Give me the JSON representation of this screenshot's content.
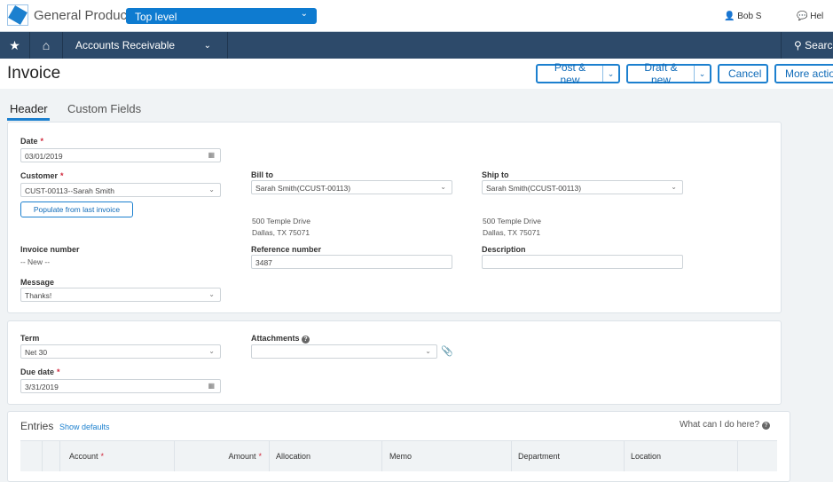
{
  "topbar": {
    "product": "General Product",
    "entity": "Top level",
    "user": "Bob S",
    "help": "Hel"
  },
  "nav": {
    "module": "Accounts Receivable",
    "search": "Search"
  },
  "page": {
    "title": "Invoice"
  },
  "actions": {
    "post_new": "Post & new",
    "draft_new": "Draft & new",
    "cancel": "Cancel",
    "more": "More action"
  },
  "tabs": [
    "Header",
    "Custom Fields"
  ],
  "header": {
    "date_label": "Date",
    "date_value": "03/01/2019",
    "customer_label": "Customer",
    "customer_value": "CUST-00113--Sarah Smith",
    "populate_button": "Populate from last invoice",
    "bill_to_label": "Bill to",
    "bill_to_value": "Sarah Smith(CCUST-00113)",
    "bill_addr1": "500 Temple Drive",
    "bill_addr2": "Dallas, TX 75071",
    "ship_to_label": "Ship to",
    "ship_to_value": "Sarah Smith(CCUST-00113)",
    "ship_addr1": "500 Temple Drive",
    "ship_addr2": "Dallas, TX 75071",
    "invoice_number_label": "Invoice number",
    "invoice_number_value": "-- New --",
    "reference_label": "Reference number",
    "reference_value": "3487",
    "description_label": "Description",
    "description_value": "",
    "message_label": "Message",
    "message_value": "Thanks!"
  },
  "terms": {
    "term_label": "Term",
    "term_value": "Net 30",
    "attachments_label": "Attachments",
    "attachments_value": "",
    "due_label": "Due date",
    "due_value": "3/31/2019"
  },
  "entries": {
    "title": "Entries",
    "show_defaults": "Show defaults",
    "help": "What can I do here?",
    "columns": [
      "Account",
      "Amount",
      "Allocation",
      "Memo",
      "Department",
      "Location"
    ]
  },
  "required_mark": "*"
}
